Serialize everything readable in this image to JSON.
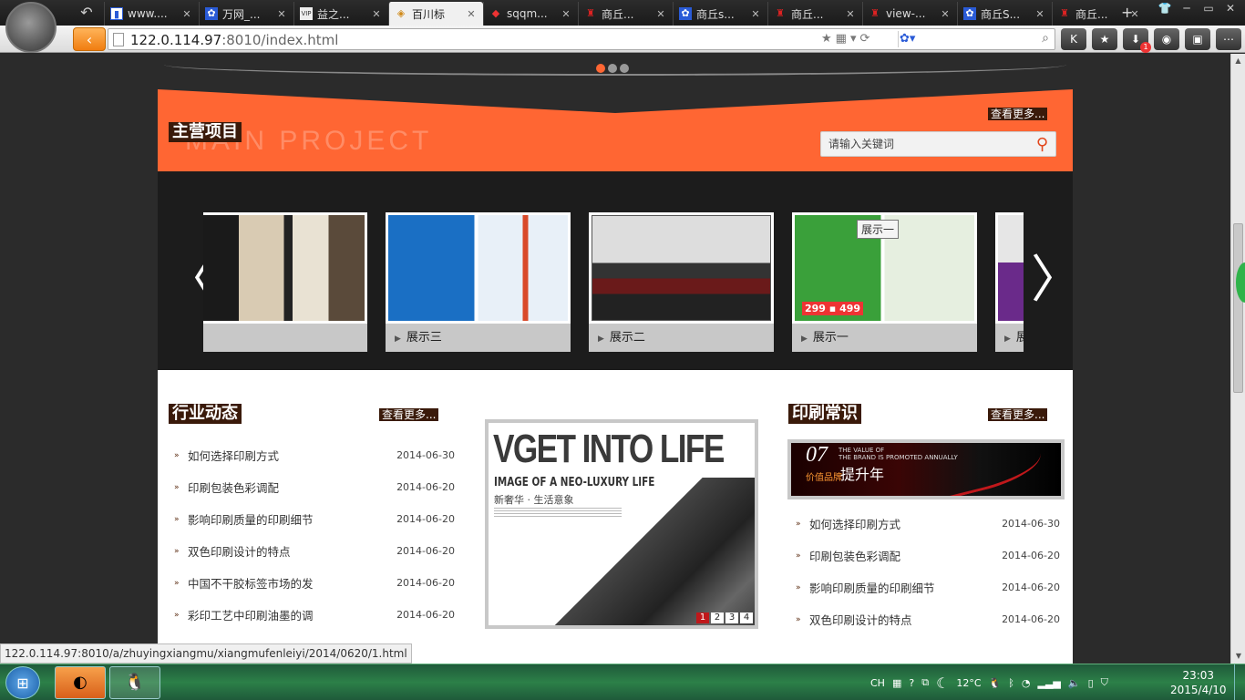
{
  "browser": {
    "tabs": [
      {
        "label": "www....",
        "favicon": "blue-white",
        "active": false
      },
      {
        "label": "万网_...",
        "favicon": "paw",
        "active": false
      },
      {
        "label": "益之...",
        "favicon": "vip",
        "active": false
      },
      {
        "label": "百川标",
        "favicon": "layers",
        "active": true
      },
      {
        "label": "sqqm...",
        "favicon": "diamond",
        "active": false
      },
      {
        "label": "商丘...",
        "favicon": "red-logo",
        "active": false
      },
      {
        "label": "商丘s...",
        "favicon": "paw",
        "active": false
      },
      {
        "label": "商丘...",
        "favicon": "red-logo",
        "active": false
      },
      {
        "label": "view-...",
        "favicon": "red-logo",
        "active": false
      },
      {
        "label": "商丘S...",
        "favicon": "paw",
        "active": false
      },
      {
        "label": "商丘...",
        "favicon": "red-logo",
        "active": false
      }
    ],
    "url_host": "122.0.114.97",
    "url_rest": ":8010/index.html",
    "download_badge": "1",
    "status_url": "122.0.114.97:8010/a/zhuyingxiangmu/xiangmufenleiyi/2014/0620/1.html"
  },
  "main_project": {
    "title": "主营项目",
    "title_en": "MAIN PROJECT",
    "more": "查看更多...",
    "search_placeholder": "请输入关键词",
    "items": [
      {
        "label": "",
        "theme": "brochure"
      },
      {
        "label": "展示三",
        "theme": "unicom"
      },
      {
        "label": "展示二",
        "theme": "car"
      },
      {
        "label": "展示一",
        "theme": "sanitary"
      },
      {
        "label": "展示五",
        "theme": "purple"
      }
    ],
    "tooltip": "展示一"
  },
  "industry_news": {
    "title": "行业动态",
    "more": "查看更多...",
    "items": [
      {
        "title": "如何选择印刷方式",
        "date": "2014-06-30"
      },
      {
        "title": "印刷包装色彩调配",
        "date": "2014-06-20"
      },
      {
        "title": "影响印刷质量的印刷细节",
        "date": "2014-06-20"
      },
      {
        "title": "双色印刷设计的特点",
        "date": "2014-06-20"
      },
      {
        "title": "中国不干胶标签市场的发",
        "date": "2014-06-20"
      },
      {
        "title": "彩印工艺中印刷油墨的调",
        "date": "2014-06-20"
      }
    ]
  },
  "feature": {
    "headline": "VGET INTO LIFE",
    "subline": "IMAGE OF A  NEO-LUXURY LIFE",
    "cn": "新奢华 · 生活意象",
    "pages": [
      "1",
      "2",
      "3",
      "4"
    ],
    "active_page": "1"
  },
  "printing_knowledge": {
    "title": "印刷常识",
    "more": "查看更多...",
    "banner": {
      "num": "07",
      "en": "THE VALUE OF\nTHE BRAND IS PROMOTED ANNUALLY",
      "cn_small": "价值品牌",
      "cn_big": "提升年"
    },
    "items": [
      {
        "title": "如何选择印刷方式",
        "date": "2014-06-30"
      },
      {
        "title": "印刷包装色彩调配",
        "date": "2014-06-20"
      },
      {
        "title": "影响印刷质量的印刷细节",
        "date": "2014-06-20"
      },
      {
        "title": "双色印刷设计的特点",
        "date": "2014-06-20"
      }
    ]
  },
  "taskbar": {
    "lang": "CH",
    "temperature": "12°C",
    "time": "23:03",
    "date": "2015/4/10"
  },
  "colors": {
    "accent": "#ff6633",
    "label_bg": "#3a1a0a",
    "dark_gallery": "#1c1c1c"
  }
}
